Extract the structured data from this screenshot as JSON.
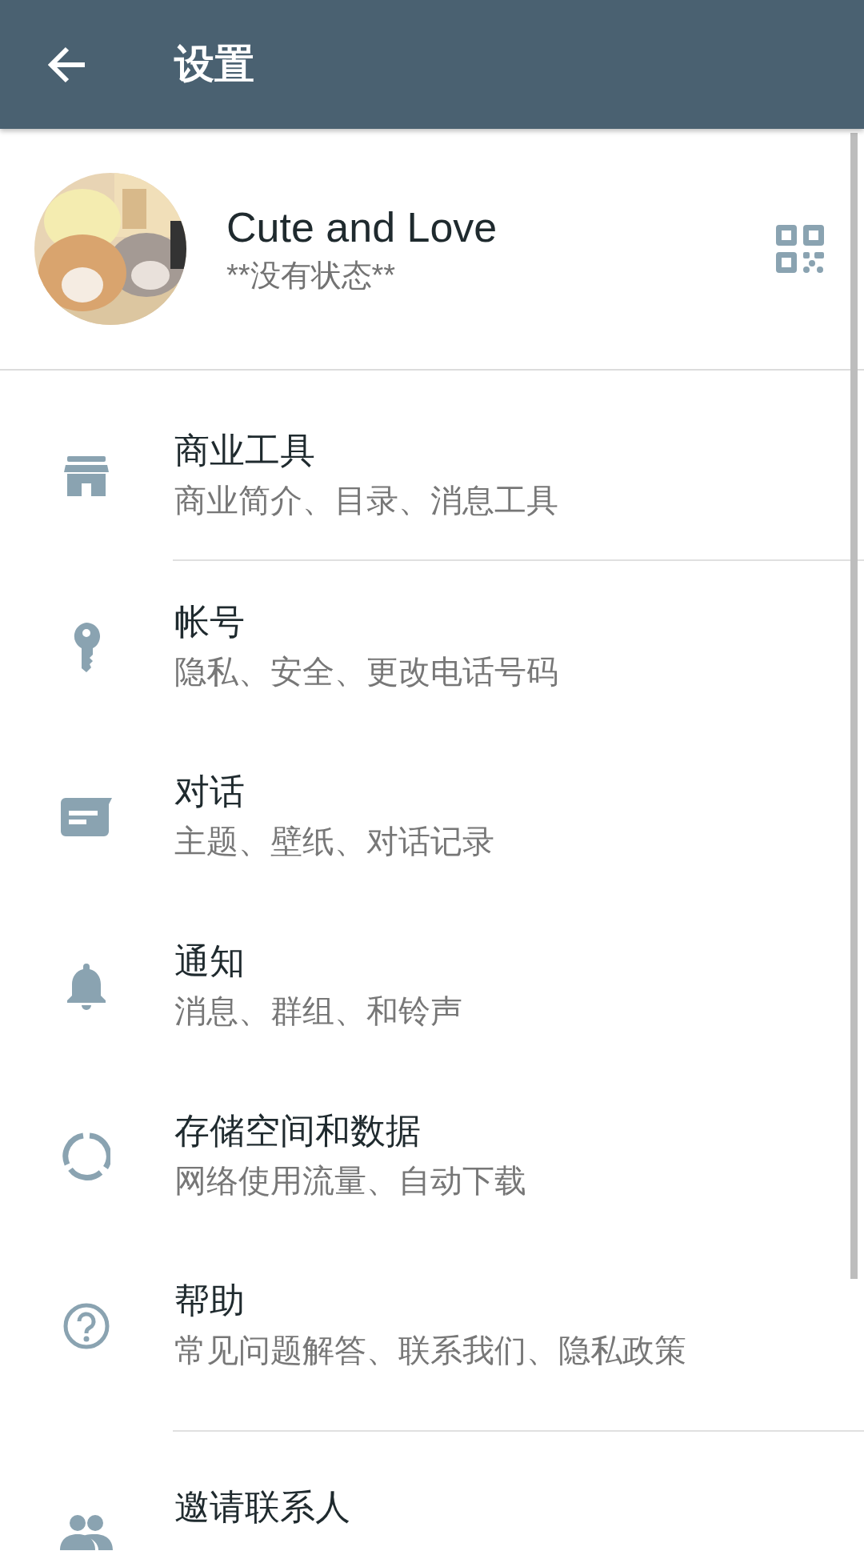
{
  "header": {
    "title": "设置"
  },
  "profile": {
    "name": "Cute and Love",
    "status": "**没有状态**"
  },
  "sections": [
    {
      "items": [
        {
          "title": "商业工具",
          "subtitle": "商业简介、目录、消息工具"
        }
      ]
    },
    {
      "items": [
        {
          "title": "帐号",
          "subtitle": "隐私、安全、更改电话号码"
        },
        {
          "title": "对话",
          "subtitle": "主题、壁纸、对话记录"
        },
        {
          "title": "通知",
          "subtitle": "消息、群组、和铃声"
        },
        {
          "title": "存储空间和数据",
          "subtitle": "网络使用流量、自动下载"
        },
        {
          "title": "帮助",
          "subtitle": "常见问题解答、联系我们、隐私政策"
        }
      ]
    },
    {
      "items": [
        {
          "title": "邀请联系人"
        }
      ]
    }
  ]
}
